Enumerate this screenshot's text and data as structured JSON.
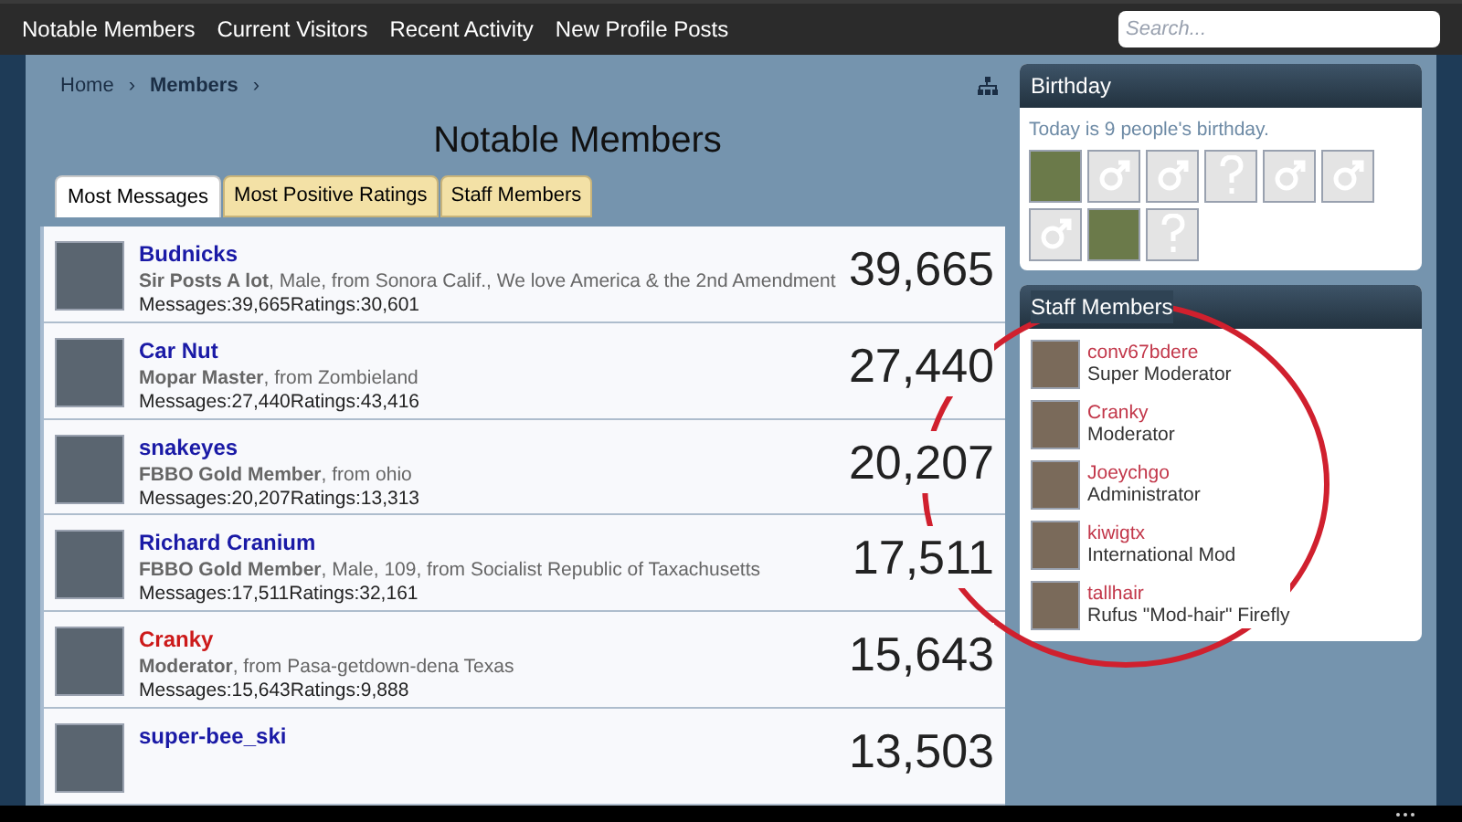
{
  "nav": {
    "links": [
      "Notable Members",
      "Current Visitors",
      "Recent Activity",
      "New Profile Posts"
    ],
    "search": {
      "placeholder": "Search..."
    }
  },
  "breadcrumb": [
    {
      "label": "Home",
      "sep": "›"
    },
    {
      "label": "Members",
      "sep": "›"
    }
  ],
  "title": "Notable Members",
  "tabs": [
    {
      "label": "Most Messages",
      "selected": true
    },
    {
      "label": "Most Positive Ratings",
      "selected": false
    },
    {
      "label": "Staff Members",
      "selected": false
    }
  ],
  "members": [
    {
      "name": "Budnicks",
      "color": "#1a1aa6",
      "title": "Sir Posts A lot",
      "info": ", Male, from Sonora Calif., We love America & the 2nd Amendment",
      "stats": "Messages:39,665Ratings:30,601",
      "count": "39,665"
    },
    {
      "name": "Car Nut",
      "color": "#1a1aa6",
      "title": "Mopar Master",
      "info": ", from Zombieland",
      "stats": "Messages:27,440Ratings:43,416",
      "count": "27,440"
    },
    {
      "name": "snakeyes",
      "color": "#1a1aa6",
      "title": "FBBO Gold Member",
      "info": ", from ohio",
      "stats": "Messages:20,207Ratings:13,313",
      "count": "20,207"
    },
    {
      "name": "Richard Cranium",
      "color": "#1a1aa6",
      "title": "FBBO Gold Member",
      "info": ", Male, 109, from Socialist Republic of Taxachusetts",
      "stats": "Messages:17,511Ratings:32,161",
      "count": "17,511"
    },
    {
      "name": "Cranky",
      "color": "#cc1a1a",
      "title": "Moderator",
      "info": ", from Pasa-getdown-dena Texas",
      "stats": "Messages:15,643Ratings:9,888",
      "count": "15,643"
    },
    {
      "name": "super-bee_ski",
      "color": "#1a1aa6",
      "count": "13,503"
    }
  ],
  "birthday": {
    "heading": "Birthday",
    "text": "Today is 9 people's birthday.",
    "avatars": [
      {
        "kind": "photo"
      },
      {
        "kind": "male"
      },
      {
        "kind": "male"
      },
      {
        "kind": "unknown"
      },
      {
        "kind": "male"
      },
      {
        "kind": "male"
      },
      {
        "kind": "male"
      },
      {
        "kind": "photo"
      },
      {
        "kind": "unknown"
      }
    ]
  },
  "staff": {
    "heading": "Staff Members",
    "members": [
      {
        "name": "conv67bdere",
        "role": "Super Moderator"
      },
      {
        "name": "Cranky",
        "role": "Moderator"
      },
      {
        "name": "Joeychgo",
        "role": "Administrator"
      },
      {
        "name": "kiwigtx",
        "role": "International Mod"
      },
      {
        "name": "tallhair",
        "role": "Rufus \"Mod-hair\" Firefly"
      }
    ]
  }
}
